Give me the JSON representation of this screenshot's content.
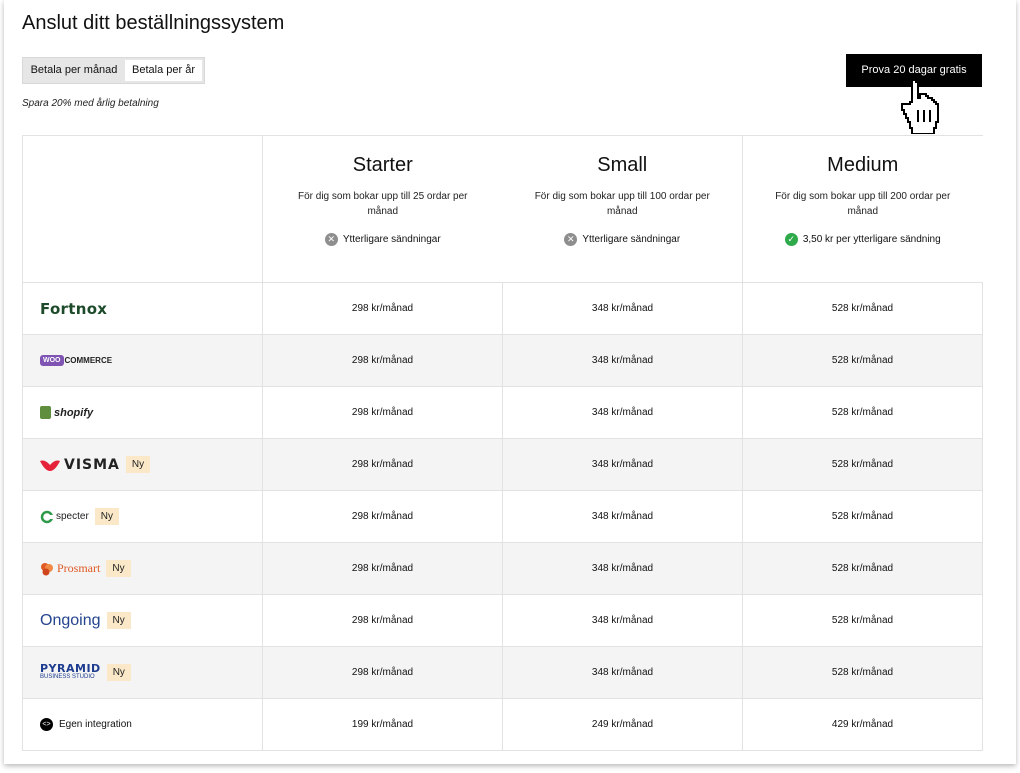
{
  "page": {
    "title": "Anslut ditt beställningssystem",
    "billing_toggle": {
      "monthly": "Betala per månad",
      "yearly": "Betala per år",
      "selected": "yearly"
    },
    "save_note": "Spara 20% med årlig betalning",
    "cta": "Prova 20 dagar gratis"
  },
  "plans": [
    {
      "name": "Starter",
      "desc": "För dig som bokar upp till 25 ordar per månad",
      "extra": "Ytterligare sändningar",
      "extra_icon": "x-circle-icon"
    },
    {
      "name": "Small",
      "desc": "För dig som bokar upp till 100 ordar per månad",
      "extra": "Ytterligare sändningar",
      "extra_icon": "x-circle-icon"
    },
    {
      "name": "Medium",
      "desc": "För dig som bokar upp till 200 ordar per månad",
      "extra": "3,50 kr per ytterligare sändning",
      "extra_icon": "check-circle-icon"
    }
  ],
  "rows": [
    {
      "brand": "Fortnox",
      "badge": "",
      "prices": [
        "298 kr/månad",
        "348 kr/månad",
        "528 kr/månad"
      ]
    },
    {
      "brand": "WooCommerce",
      "logo_text_a": "WOO",
      "logo_text_b": "COMMERCE",
      "badge": "",
      "prices": [
        "298 kr/månad",
        "348 kr/månad",
        "528 kr/månad"
      ]
    },
    {
      "brand": "shopify",
      "badge": "",
      "prices": [
        "298 kr/månad",
        "348 kr/månad",
        "528 kr/månad"
      ]
    },
    {
      "brand": "VISMA",
      "badge": "Ny",
      "prices": [
        "298 kr/månad",
        "348 kr/månad",
        "528 kr/månad"
      ]
    },
    {
      "brand": "specter",
      "badge": "Ny",
      "prices": [
        "298 kr/månad",
        "348 kr/månad",
        "528 kr/månad"
      ]
    },
    {
      "brand": "Prosmart",
      "badge": "Ny",
      "prices": [
        "298 kr/månad",
        "348 kr/månad",
        "528 kr/månad"
      ]
    },
    {
      "brand": "Ongoing",
      "badge": "Ny",
      "prices": [
        "298 kr/månad",
        "348 kr/månad",
        "528 kr/månad"
      ]
    },
    {
      "brand": "PYRAMID",
      "logo_sub": "BUSINESS STUDIO",
      "badge": "Ny",
      "prices": [
        "298 kr/månad",
        "348 kr/månad",
        "528 kr/månad"
      ]
    },
    {
      "brand": "Egen integration",
      "badge": "",
      "prices": [
        "199 kr/månad",
        "249 kr/månad",
        "429 kr/månad"
      ]
    }
  ],
  "colors": {
    "cta_bg": "#000000",
    "badge_bg": "#fbe8c8",
    "check": "#2eaa4a",
    "x_icon": "#8e8e8e",
    "alt_row": "#f4f4f4"
  }
}
